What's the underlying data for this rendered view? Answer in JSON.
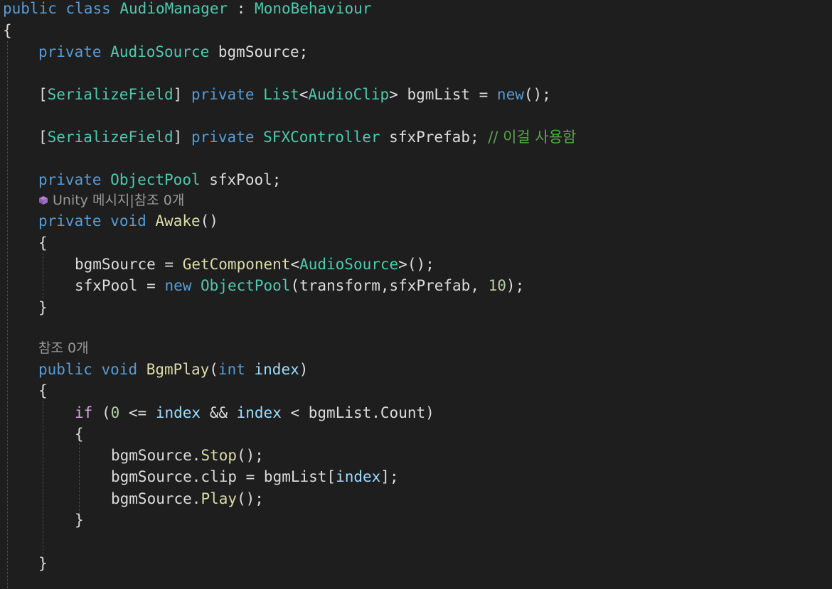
{
  "editor": {
    "l1": {
      "kw1": "public",
      "kw2": "class",
      "cls": "AudioManager",
      "sep": " : ",
      "base": "MonoBehaviour"
    },
    "l2": {
      "brace": "{"
    },
    "l3": {
      "kw": "private",
      "type": "AudioSource",
      "rest": " bgmSource;"
    },
    "l5": {
      "b1": "[",
      "attr": "SerializeField",
      "b2": "]",
      "kw": "private",
      "type": "List",
      "lt": "<",
      "arg": "AudioClip",
      "gt": ">",
      "name": " bgmList = ",
      "newkw": "new",
      "end": "();"
    },
    "l7": {
      "b1": "[",
      "attr": "SerializeField",
      "b2": "]",
      "kw": "private",
      "type": "SFXController",
      "name": " sfxPrefab; ",
      "comment": "// 이걸 사용함"
    },
    "l9": {
      "kw": "private",
      "type": "ObjectPool",
      "rest": " sfxPool;"
    },
    "lens1": {
      "text": "Unity 메시지|참조 0개"
    },
    "l10": {
      "kw1": "private",
      "kw2": "void",
      "fn": "Awake",
      "rest": "()"
    },
    "l11": {
      "brace": "{"
    },
    "l12": {
      "a": "bgmSource = ",
      "fn": "GetComponent",
      "lt": "<",
      "type": "AudioSource",
      "rest": ">();"
    },
    "l13": {
      "a": "sfxPool = ",
      "newkw": "new",
      "type": "ObjectPool",
      "rest": "(transform,sfxPrefab, ",
      "num": "10",
      "end": ");"
    },
    "l14": {
      "brace": "}"
    },
    "lens2": {
      "text": "참조 0개"
    },
    "l16": {
      "kw1": "public",
      "kw2": "void",
      "fn": "BgmPlay",
      "p1": "(",
      "kw3": "int",
      "param": "index",
      "p2": ")"
    },
    "l17": {
      "brace": "{"
    },
    "l18": {
      "ctl": "if",
      "a": " (",
      "num": "0",
      "b": " <= ",
      "p1": "index",
      "c": " && ",
      "p2": "index",
      "d": " < bgmList.Count)"
    },
    "l19": {
      "brace": "{"
    },
    "l20": {
      "a": "bgmSource.",
      "fn": "Stop",
      "rest": "();"
    },
    "l21": {
      "a": "bgmSource.clip = bgmList[",
      "param": "index",
      "rest": "];"
    },
    "l22": {
      "a": "bgmSource.",
      "fn": "Play",
      "rest": "();"
    },
    "l23": {
      "brace": "}"
    },
    "l25": {
      "brace": "}"
    }
  }
}
